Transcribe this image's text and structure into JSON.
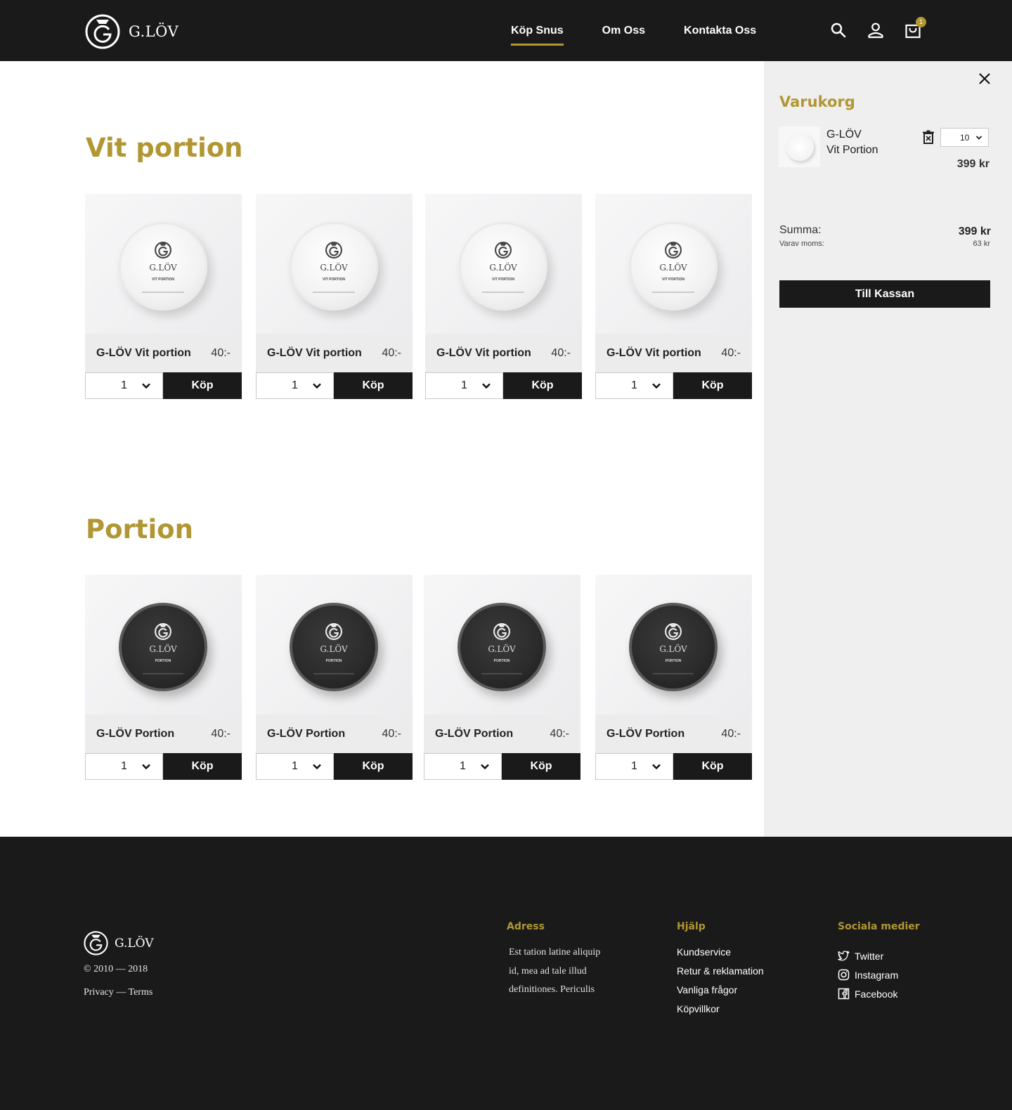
{
  "brand": {
    "name": "G.LÖV",
    "accent_color": "#b19733",
    "dark_color": "#1a1a1a"
  },
  "nav": {
    "items": [
      {
        "label": "Köp Snus",
        "active": true
      },
      {
        "label": "Om Oss",
        "active": false
      },
      {
        "label": "Kontakta Oss",
        "active": false
      }
    ],
    "icons": [
      "search-icon",
      "user-icon",
      "shopping-bag-icon"
    ],
    "cart_count": "1"
  },
  "sections": [
    {
      "title": "Vit portion",
      "products": [
        {
          "name": "G-LÖV Vit portion",
          "price": "40:-",
          "qty": "1",
          "buy_label": "Köp",
          "tin_label": "VIT PORTION",
          "tin_brand": "G.LÖV"
        },
        {
          "name": "G-LÖV Vit portion",
          "price": "40:-",
          "qty": "1",
          "buy_label": "Köp",
          "tin_label": "VIT PORTION",
          "tin_brand": "G.LÖV"
        },
        {
          "name": "G-LÖV Vit portion",
          "price": "40:-",
          "qty": "1",
          "buy_label": "Köp",
          "tin_label": "VIT PORTION",
          "tin_brand": "G.LÖV"
        },
        {
          "name": "G-LÖV Vit portion",
          "price": "40:-",
          "qty": "1",
          "buy_label": "Köp",
          "tin_label": "VIT PORTION",
          "tin_brand": "G.LÖV"
        }
      ]
    },
    {
      "title": "Portion",
      "products": [
        {
          "name": "G-LÖV Portion",
          "price": "40:-",
          "qty": "1",
          "buy_label": "Köp",
          "tin_label": "PORTION",
          "tin_brand": "G.LÖV"
        },
        {
          "name": "G-LÖV Portion",
          "price": "40:-",
          "qty": "1",
          "buy_label": "Köp",
          "tin_label": "PORTION",
          "tin_brand": "G.LÖV"
        },
        {
          "name": "G-LÖV Portion",
          "price": "40:-",
          "qty": "1",
          "buy_label": "Köp",
          "tin_label": "PORTION",
          "tin_brand": "G.LÖV"
        },
        {
          "name": "G-LÖV Portion",
          "price": "40:-",
          "qty": "1",
          "buy_label": "Köp",
          "tin_label": "PORTION",
          "tin_brand": "G.LÖV"
        }
      ]
    }
  ],
  "cart": {
    "title": "Varukorg",
    "item": {
      "brand": "G-LÖV",
      "name": "Vit Portion",
      "qty": "10",
      "price": "399 kr"
    },
    "sum_label": "Summa:",
    "sum_value": "399 kr",
    "moms_label": "Varav moms:",
    "moms_value": "63 kr",
    "checkout_label": "Till Kassan"
  },
  "footer": {
    "brand": "G.LÖV",
    "copyright": "© 2010 — 2018",
    "privacy": "Privacy",
    "terms": "Terms",
    "separator": " — ",
    "address_heading": "Adress",
    "address_text": "Est tation latine aliquip id, mea ad tale illud definitiones. Periculis",
    "help_heading": "Hjälp",
    "help_links": [
      "Kundservice",
      "Retur & reklamation",
      "Vanliga frågor",
      "Köpvillkor"
    ],
    "social_heading": "Sociala medier",
    "social_links": [
      {
        "label": "Twitter",
        "icon": "twitter-icon"
      },
      {
        "label": "Instagram",
        "icon": "instagram-icon"
      },
      {
        "label": "Facebook",
        "icon": "facebook-icon"
      }
    ]
  }
}
